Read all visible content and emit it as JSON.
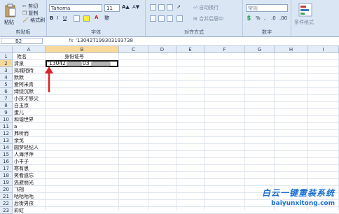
{
  "ribbon": {
    "clipboard": {
      "label": "剪贴板",
      "paste": "粘贴",
      "cut": "剪切",
      "copy": "复制",
      "format_painter": "格式刷"
    },
    "font": {
      "label": "字体",
      "font_name": "Tahoma",
      "font_size": "11"
    },
    "alignment": {
      "label": "对齐方式",
      "wrap_text": "自动换行",
      "merge_center": "合并后居中"
    },
    "number": {
      "label": "数字",
      "format": "常规"
    },
    "styles": {
      "conditional_format": "条件格式"
    }
  },
  "formula_bar": {
    "name_box": "B2",
    "fx": "fx",
    "formula": "'13042T199303193738"
  },
  "grid": {
    "columns": [
      "A",
      "B",
      "C",
      "D",
      "E",
      "F",
      "G",
      "H",
      "I"
    ],
    "rows": [
      "1",
      "2",
      "3",
      "4",
      "5",
      "6",
      "7",
      "8",
      "9",
      "10",
      "11",
      "12",
      "13",
      "14",
      "15",
      "16",
      "17",
      "18",
      "19",
      "20",
      "21",
      "22",
      "23"
    ],
    "col_a": [
      "姓名",
      "清泉",
      "拟城相待",
      "默默",
      "爱阿米青",
      "绿绕沉默",
      "小孩才够尖",
      "白玉京",
      "蛋儿",
      "和谐世界",
      "a",
      "弗听而",
      "余戈",
      "圆梦轻纪人",
      "人海浮萍",
      "小丰子",
      "寒有思",
      "笑看遗忘",
      "逃避丽光",
      "飞翔",
      "咕咕咕咕",
      "后街男孩",
      "彩虹"
    ],
    "b1": "身份证号",
    "b2_prefix": "'13042",
    "b2_suffix": "03"
  },
  "watermark": {
    "title": "白云一键重装系统",
    "url": "baiyunxitong.com"
  }
}
